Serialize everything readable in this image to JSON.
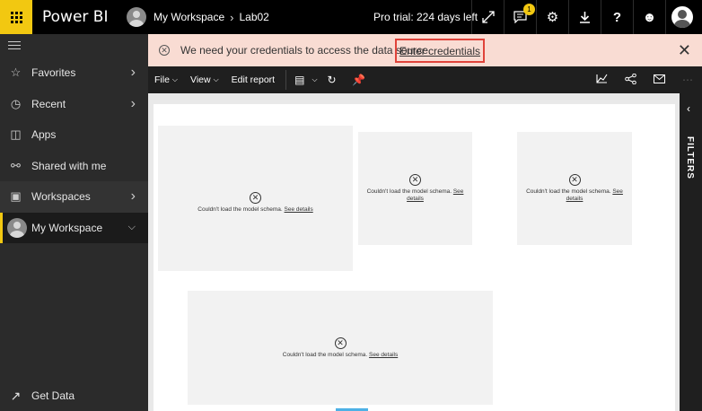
{
  "app": {
    "brand": "Power BI"
  },
  "header": {
    "breadcrumb": [
      "My Workspace",
      "Lab02"
    ],
    "trial_text": "Pro trial: 224 days left",
    "notification_count": "1",
    "icons": [
      "expand-icon",
      "chat-icon",
      "gear-icon",
      "download-icon",
      "help-icon",
      "smiley-icon",
      "avatar"
    ]
  },
  "sidebar": {
    "items": [
      {
        "label": "Favorites",
        "icon": "star-icon",
        "chevron": true
      },
      {
        "label": "Recent",
        "icon": "clock-icon",
        "chevron": true
      },
      {
        "label": "Apps",
        "icon": "apps-icon",
        "chevron": false
      },
      {
        "label": "Shared with me",
        "icon": "shared-icon",
        "chevron": false
      },
      {
        "label": "Workspaces",
        "icon": "workspaces-icon",
        "chevron": true
      },
      {
        "label": "My Workspace",
        "icon": "avatar",
        "chevron": true,
        "active": true
      }
    ],
    "get_data": "Get Data"
  },
  "notification": {
    "message": "We need your credentials to access the data source.",
    "link": "Enter credentials"
  },
  "toolbar": {
    "file": "File",
    "view": "View",
    "edit_report": "Edit report"
  },
  "tiles": [
    {
      "message": "Couldn't load the model schema.",
      "link": "See details"
    },
    {
      "message": "Couldn't load the model schema.",
      "link": "See details"
    },
    {
      "message": "Couldn't load the model schema.",
      "link": "See details"
    },
    {
      "message": "Couldn't load the model schema.",
      "link": "See details"
    }
  ],
  "filters": {
    "label": "FILTERS"
  },
  "colors": {
    "accent": "#f2c811",
    "alert_bg": "#f9dcd3",
    "highlight": "#e0433a"
  }
}
